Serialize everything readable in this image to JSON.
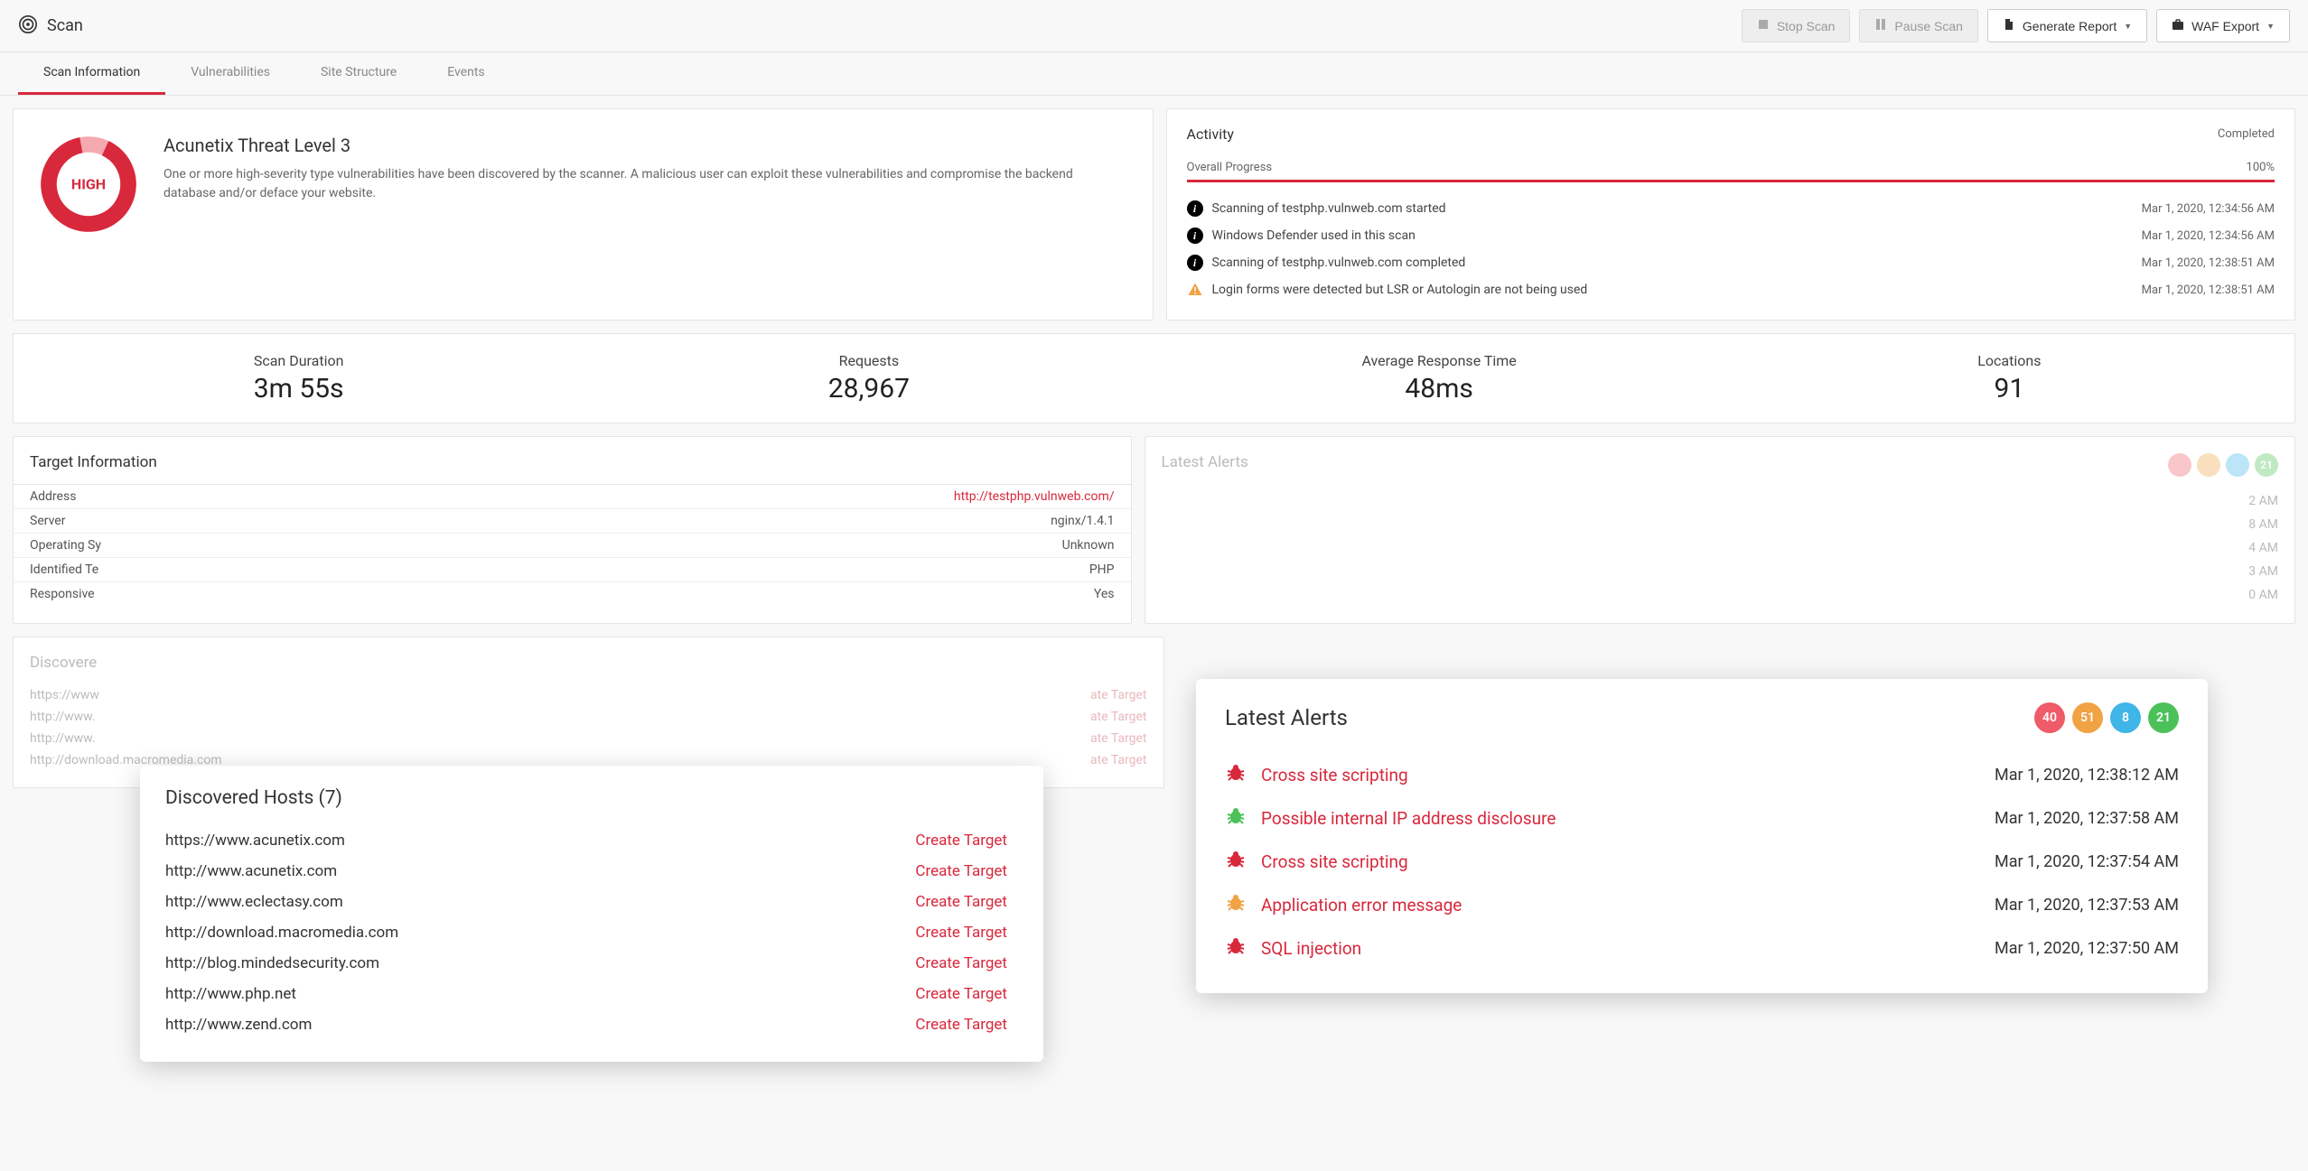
{
  "header": {
    "title": "Scan",
    "buttons": {
      "stop": "Stop Scan",
      "pause": "Pause Scan",
      "report": "Generate Report",
      "waf": "WAF Export"
    }
  },
  "tabs": [
    "Scan Information",
    "Vulnerabilities",
    "Site Structure",
    "Events"
  ],
  "threat": {
    "level_label": "HIGH",
    "title": "Acunetix Threat Level 3",
    "description": "One or more high-severity type vulnerabilities have been discovered by the scanner. A malicious user can exploit these vulnerabilities and compromise the backend database and/or deface your website."
  },
  "activity": {
    "title": "Activity",
    "status": "Completed",
    "progress_label": "Overall Progress",
    "progress_value": "100%",
    "events": [
      {
        "type": "info",
        "text": "Scanning of testphp.vulnweb.com started",
        "time": "Mar 1, 2020, 12:34:56 AM"
      },
      {
        "type": "info",
        "text": "Windows Defender used in this scan",
        "time": "Mar 1, 2020, 12:34:56 AM"
      },
      {
        "type": "info",
        "text": "Scanning of testphp.vulnweb.com completed",
        "time": "Mar 1, 2020, 12:38:51 AM"
      },
      {
        "type": "warn",
        "text": "Login forms were detected but LSR or Autologin are not being used",
        "time": "Mar 1, 2020, 12:38:51 AM"
      }
    ]
  },
  "stats": {
    "duration": {
      "label": "Scan Duration",
      "value": "3m 55s"
    },
    "requests": {
      "label": "Requests",
      "value": "28,967"
    },
    "response": {
      "label": "Average Response Time",
      "value": "48ms"
    },
    "locations": {
      "label": "Locations",
      "value": "91"
    }
  },
  "target": {
    "title": "Target Information",
    "rows": [
      {
        "key": "Address",
        "value": "http://testphp.vulnweb.com/",
        "link": true
      },
      {
        "key": "Server",
        "value": "nginx/1.4.1"
      },
      {
        "key": "Operating Sy",
        "value": "Unknown"
      },
      {
        "key": "Identified Te",
        "value": "PHP"
      },
      {
        "key": "Responsive",
        "value": "Yes"
      }
    ]
  },
  "discovered_bg": {
    "title": "Discovere",
    "create_label": "ate Target",
    "rows": [
      "https://www",
      "http://www.",
      "http://www.",
      "http://download.macromedia.com"
    ]
  },
  "alerts_bg": {
    "title": "Latest Alerts",
    "badges": {
      "red": "",
      "orange": "",
      "blue": "",
      "green": "21"
    },
    "rows": [
      {
        "time": "2 AM"
      },
      {
        "time": "8 AM"
      },
      {
        "time": "4 AM"
      },
      {
        "time": "3 AM"
      },
      {
        "time": "0 AM"
      }
    ]
  },
  "hosts_popup": {
    "title": "Discovered Hosts (7)",
    "create_label": "Create Target",
    "hosts": [
      "https://www.acunetix.com",
      "http://www.acunetix.com",
      "http://www.eclectasy.com",
      "http://download.macromedia.com",
      "http://blog.mindedsecurity.com",
      "http://www.php.net",
      "http://www.zend.com"
    ]
  },
  "alerts_popup": {
    "title": "Latest Alerts",
    "badges": {
      "red": "40",
      "orange": "51",
      "blue": "8",
      "green": "21"
    },
    "alerts": [
      {
        "sev": "red",
        "name": "Cross site scripting",
        "time": "Mar 1, 2020, 12:38:12 AM"
      },
      {
        "sev": "green",
        "name": "Possible internal IP address disclosure",
        "time": "Mar 1, 2020, 12:37:58 AM"
      },
      {
        "sev": "red",
        "name": "Cross site scripting",
        "time": "Mar 1, 2020, 12:37:54 AM"
      },
      {
        "sev": "orange",
        "name": "Application error message",
        "time": "Mar 1, 2020, 12:37:53 AM"
      },
      {
        "sev": "red",
        "name": "SQL injection",
        "time": "Mar 1, 2020, 12:37:50 AM"
      }
    ]
  }
}
